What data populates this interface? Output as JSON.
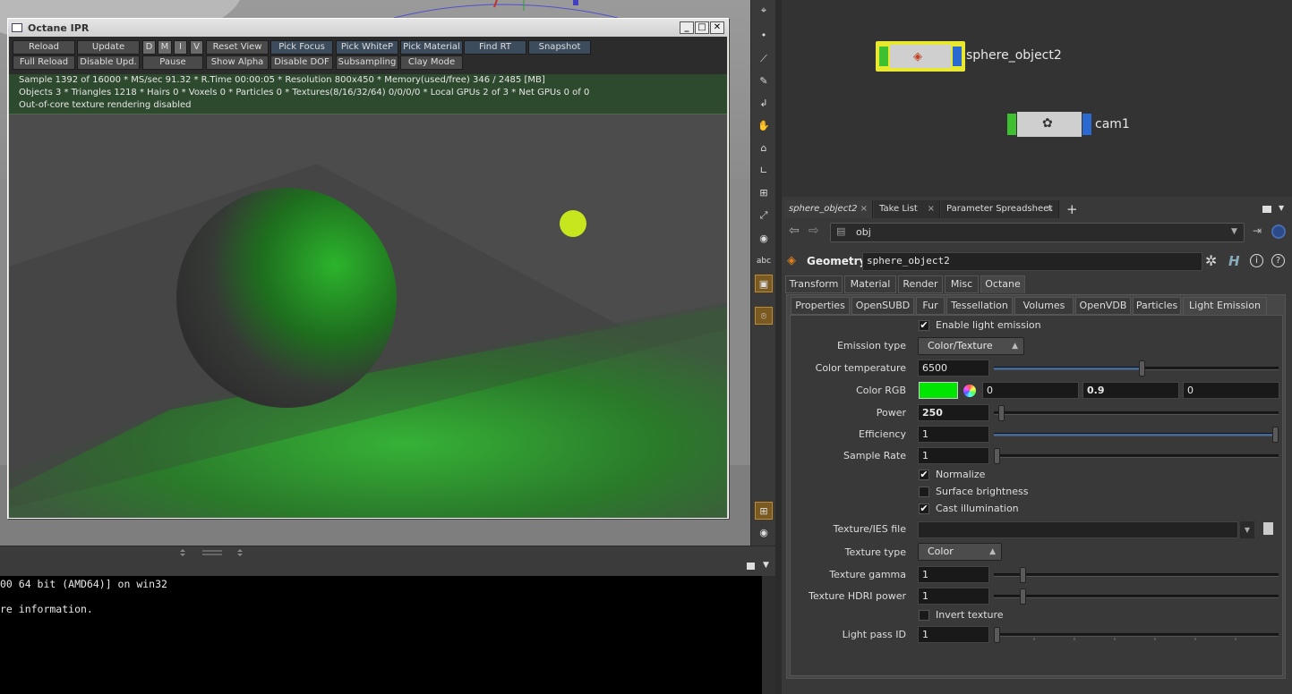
{
  "ipr": {
    "title": "Octane IPR",
    "win_min": "_",
    "win_max": "□",
    "win_close": "✕",
    "toolbar_row1": [
      "Reload",
      "Update",
      "D",
      "M",
      "I",
      "V",
      "Reset View",
      "Pick Focus",
      "Pick WhiteP",
      "Pick Material",
      "Find RT",
      "Snapshot"
    ],
    "toolbar_row2": [
      "Full Reload",
      "Disable Upd.",
      "Pause",
      "Show Alpha",
      "Disable DOF",
      "Subsampling",
      "Clay Mode"
    ],
    "info_line1": "Sample 1392 of 16000 * MS/sec 91.32 * R.Time 00:00:05 * Resolution 800x450 * Memory(used/free) 346 / 2485 [MB]",
    "info_line2": "Objects 3 * Triangles 1218 * Hairs 0 * Voxels 0 * Particles 0 * Textures(8/16/32/64) 0/0/0/0 * Local GPUs 2 of 3 * Net GPUs 0 of 0",
    "info_line3": "Out-of-core texture rendering disabled"
  },
  "shell": {
    "line1": "00 64 bit (AMD64)] on win32",
    "line2": "re information."
  },
  "toolstrip": {
    "abc_label": "abc"
  },
  "network": {
    "node1": "sphere_object2",
    "node2": "cam1"
  },
  "tabs": [
    {
      "label": "sphere_object2"
    },
    {
      "label": "Take List"
    },
    {
      "label": "Parameter Spreadsheet"
    }
  ],
  "tab_close": "×",
  "tab_add": "+",
  "path": {
    "value": "obj"
  },
  "node_header": {
    "type": "Geometry",
    "name": "sphere_object2"
  },
  "main_tabs": [
    "Transform",
    "Material",
    "Render",
    "Misc",
    "Octane"
  ],
  "sub_tabs": [
    "Properties",
    "OpenSUBD",
    "Fur",
    "Tessellation",
    "Volumes",
    "OpenVDB",
    "Particles",
    "Light Emission"
  ],
  "params": {
    "enable_light_emission": "Enable light emission",
    "emission_type_label": "Emission type",
    "emission_type_value": "Color/Texture",
    "color_temp_label": "Color temperature",
    "color_temp_value": "6500",
    "color_temp_level": 0.5,
    "color_rgb_label": "Color RGB",
    "color_rgb_swatch": "#00e600",
    "color_r": "0",
    "color_g": "0.9",
    "color_b": "0",
    "power_label": "Power",
    "power_value": "250",
    "efficiency_label": "Efficiency",
    "efficiency_value": "1",
    "sample_rate_label": "Sample Rate",
    "sample_rate_value": "1",
    "normalize": "Normalize",
    "surface_brightness": "Surface brightness",
    "cast_illumination": "Cast illumination",
    "texture_file_label": "Texture/IES file",
    "texture_file_value": "",
    "texture_type_label": "Texture type",
    "texture_type_value": "Color",
    "texture_gamma_label": "Texture gamma",
    "texture_gamma_value": "1",
    "texture_hdri_label": "Texture HDRI power",
    "texture_hdri_value": "1",
    "invert_texture": "Invert texture",
    "light_pass_label": "Light pass ID",
    "light_pass_value": "1",
    "check_mark": "✔"
  },
  "colors": {
    "accent": "#3a6aa8",
    "node_green": "#3ec030",
    "node_blue": "#2a6ad0",
    "node_selected": "#e8e830",
    "render_green": "#2faa2f"
  }
}
